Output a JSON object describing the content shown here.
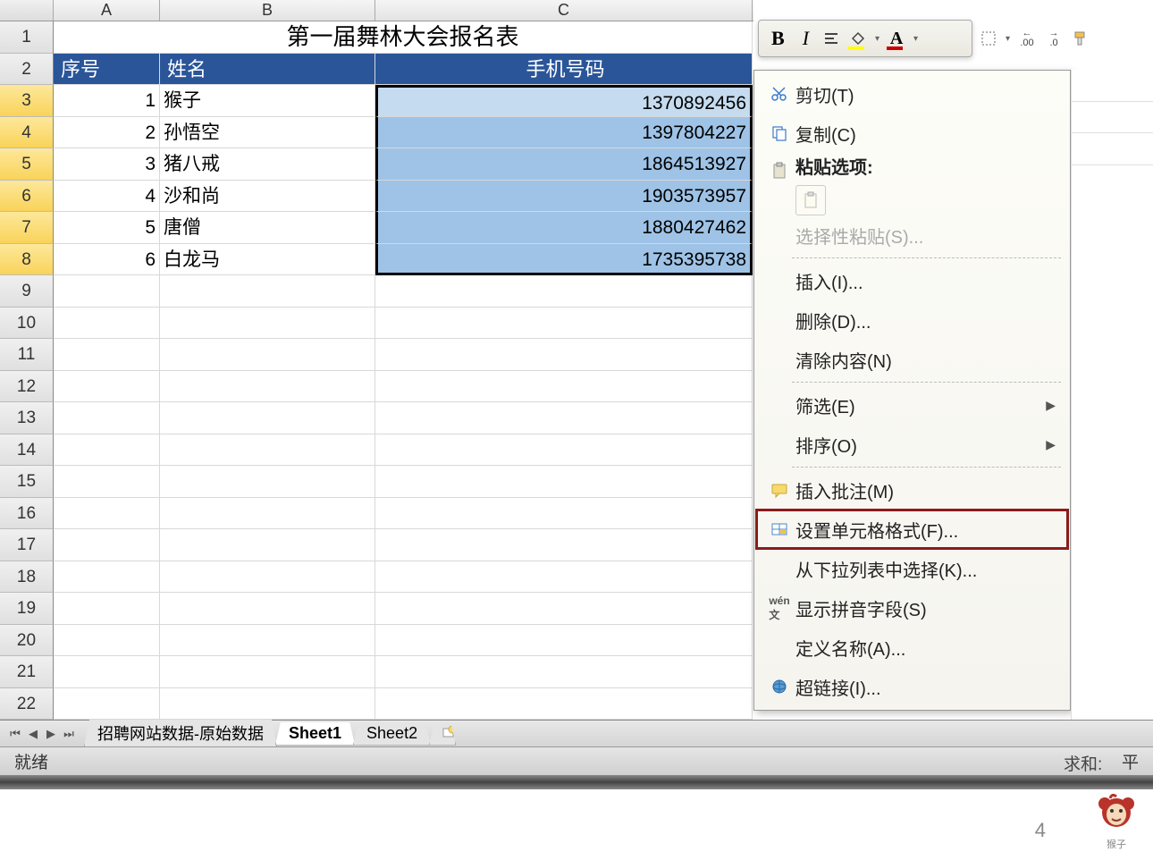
{
  "columns": {
    "a": "A",
    "b": "B",
    "c": "C"
  },
  "row_numbers": [
    "1",
    "2",
    "3",
    "4",
    "5",
    "6",
    "7",
    "8",
    "9",
    "10",
    "11",
    "12",
    "13",
    "14",
    "15",
    "16",
    "17",
    "18",
    "19",
    "20",
    "21",
    "22"
  ],
  "title": "第一届舞林大会报名表",
  "headers": {
    "seq": "序号",
    "name": "姓名",
    "phone": "手机号码"
  },
  "data": [
    {
      "seq": "1",
      "name": "猴子",
      "phone": "1370892456"
    },
    {
      "seq": "2",
      "name": "孙悟空",
      "phone": "1397804227"
    },
    {
      "seq": "3",
      "name": "猪八戒",
      "phone": "1864513927"
    },
    {
      "seq": "4",
      "name": "沙和尚",
      "phone": "1903573957"
    },
    {
      "seq": "5",
      "name": "唐僧",
      "phone": "1880427462"
    },
    {
      "seq": "6",
      "name": "白龙马",
      "phone": "1735395738"
    }
  ],
  "tabs": {
    "t1": "招聘网站数据-原始数据",
    "t2": "Sheet1",
    "t3": "Sheet2"
  },
  "status": {
    "ready": "就绪",
    "right_partial": "平",
    "right_partial2": "求和:"
  },
  "mini_toolbar": {
    "bold": "B",
    "italic": "I",
    "font_A": "A"
  },
  "ribbon_decimals": {
    "inc": ".00",
    "dec": ".0"
  },
  "context_menu": {
    "cut": "剪切(T)",
    "copy": "复制(C)",
    "paste_options": "粘贴选项:",
    "paste_special": "选择性粘贴(S)...",
    "insert": "插入(I)...",
    "delete": "删除(D)...",
    "clear": "清除内容(N)",
    "filter": "筛选(E)",
    "sort": "排序(O)",
    "insert_comment": "插入批注(M)",
    "format_cells": "设置单元格格式(F)...",
    "pick_from_list": "从下拉列表中选择(K)...",
    "show_pinyin": "显示拼音字段(S)",
    "define_name": "定义名称(A)...",
    "hyperlink": "超链接(I)..."
  },
  "page_num": "4",
  "monkey_label": "猴子"
}
